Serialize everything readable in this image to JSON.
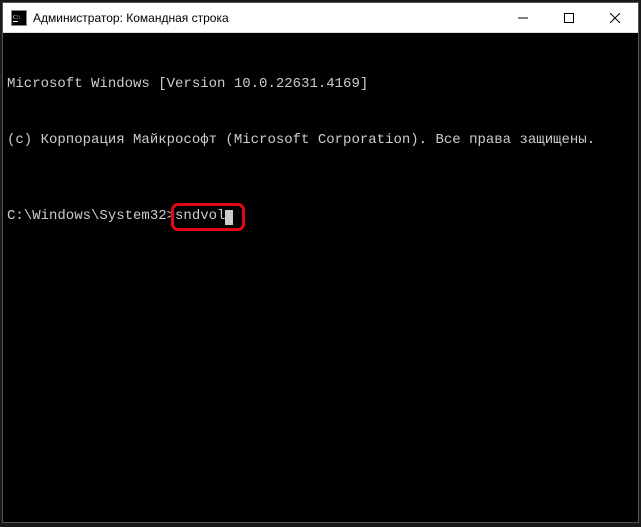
{
  "window": {
    "title": "Администратор: Командная строка"
  },
  "terminal": {
    "line1": "Microsoft Windows [Version 10.0.22631.4169]",
    "line2": "(с) Корпорация Майкрософт (Microsoft Corporation). Все права защищены.",
    "prompt": "C:\\Windows\\System32>",
    "command": "sndvol"
  }
}
